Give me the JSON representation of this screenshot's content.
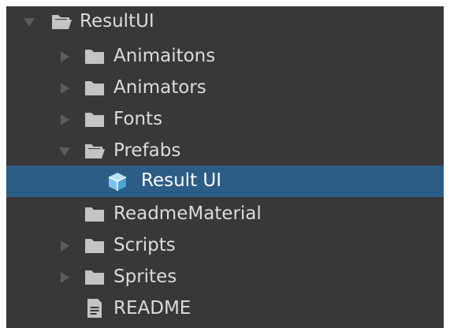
{
  "tree": {
    "items": [
      {
        "label": "ResultUI",
        "icon": "folder-open-icon",
        "expander": "expanded"
      },
      {
        "label": "Animaitons",
        "icon": "folder-icon",
        "expander": "collapsed"
      },
      {
        "label": "Animators",
        "icon": "folder-icon",
        "expander": "collapsed"
      },
      {
        "label": "Fonts",
        "icon": "folder-icon",
        "expander": "collapsed"
      },
      {
        "label": "Prefabs",
        "icon": "folder-open-icon",
        "expander": "expanded"
      },
      {
        "label": "Result UI",
        "icon": "prefab-cube-icon",
        "expander": "none",
        "selected": true
      },
      {
        "label": "ReadmeMaterial",
        "icon": "folder-icon",
        "expander": "none"
      },
      {
        "label": "Scripts",
        "icon": "folder-icon",
        "expander": "collapsed"
      },
      {
        "label": "Sprites",
        "icon": "folder-icon",
        "expander": "collapsed"
      },
      {
        "label": "README",
        "icon": "document-icon",
        "expander": "none"
      }
    ]
  },
  "colors": {
    "panel_background": "#383838",
    "selection": "#2c5d87",
    "text": "#dcdcdc",
    "icon": "#c4c4c4",
    "arrow": "#5c5c5c",
    "prefab_icon": "#7cc4ea"
  }
}
